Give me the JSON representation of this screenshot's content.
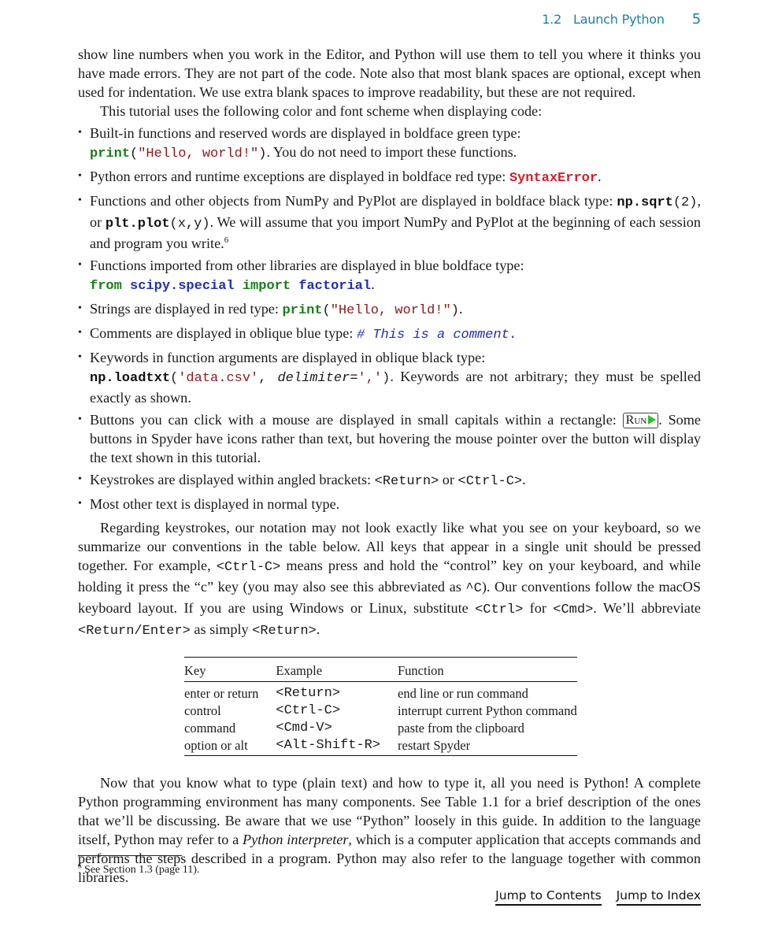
{
  "header": {
    "section_number": "1.2",
    "section_title": "Launch Python",
    "page_number": "5"
  },
  "intro": {
    "para1": "show line numbers when you work in the Editor, and Python will use them to tell you where it thinks you have made errors. They are not part of the code. Note also that most blank spaces are optional, except when used for indentation. We use extra blank spaces to improve readability, but these are not required.",
    "para2": "This tutorial uses the following color and font scheme when displaying code:"
  },
  "bullets": {
    "b1": {
      "text": "Built-in functions and reserved words are displayed in boldface green type:",
      "code_fn": "print",
      "code_open": "(",
      "code_str": "\"Hello, world!\"",
      "code_close": ")",
      "after": ". You do not need to import these functions."
    },
    "b2": {
      "text": "Python errors and runtime exceptions are displayed in boldface red type: ",
      "code": "SyntaxError",
      "after": "."
    },
    "b3": {
      "text": "Functions and other objects from NumPy and PyPlot are displayed in boldface black type: ",
      "code1_fn": "np.sqrt",
      "code1_args": "(2)",
      "mid": ", or ",
      "code2_fn": "plt.plot",
      "code2_args": "(x,y)",
      "after": ". We will assume that you import NumPy and PyPlot at the beginning of each session and program you write.",
      "footnote_ref": "6"
    },
    "b4": {
      "text": "Functions imported from other libraries are displayed in blue boldface type:",
      "kw_from": "from",
      "lib": "scipy.special",
      "kw_import": "import",
      "fn": "factorial",
      "after": "."
    },
    "b5": {
      "text": "Strings are displayed in red type: ",
      "code_fn": "print",
      "code_open": "(",
      "code_str": "\"Hello, world!\"",
      "code_close": ")",
      "after": "."
    },
    "b6": {
      "text": "Comments are displayed in oblique blue type: ",
      "code": "# This is a comment."
    },
    "b7": {
      "text": "Keywords in function arguments are displayed in oblique black type:",
      "code_fn": "np.loadtxt",
      "code_open": "(",
      "code_str1": "'data.csv'",
      "code_sep": ", ",
      "code_kwarg": "delimiter",
      "code_eq": "=",
      "code_str2": "','",
      "code_close": ")",
      "after": ". Keywords are not arbitrary; they must be spelled exactly as shown."
    },
    "b8": {
      "text": "Buttons you can click with a mouse are displayed in small capitals within a rectangle: ",
      "button_label": "Run",
      "button_icon": "play-icon",
      "after": ". Some buttons in Spyder have icons rather than text, but hovering the mouse pointer over the button will display the text shown in this tutorial."
    },
    "b9": {
      "text": "Keystrokes are displayed within angled brackets: ",
      "key1": "<Return>",
      "mid": " or ",
      "key2": "<Ctrl-C>",
      "after": "."
    },
    "b10": {
      "text": "Most other text is displayed in normal type."
    }
  },
  "keystrokes_para": {
    "t1": "Regarding keystrokes, our notation may not look exactly like what you see on your keyboard, so we summarize our conventions in the table below. All keys that appear in a single unit should be pressed together. For example, ",
    "k1": "<Ctrl-C>",
    "t2": " means press and hold the “control” key on your keyboard, and while holding it press the “c” key (you may also see this abbreviated as ",
    "k2": "^C",
    "t3": "). Our conventions follow the macOS keyboard layout. If you are using Windows or Linux, substitute ",
    "k3": "<Ctrl>",
    "t4": " for ",
    "k4": "<Cmd>",
    "t5": ". We’ll abbreviate ",
    "k5": "<Return/Enter>",
    "t6": " as simply ",
    "k6": "<Return>",
    "t7": "."
  },
  "key_table": {
    "headers": [
      "Key",
      "Example",
      "Function"
    ],
    "rows": [
      [
        "enter or return",
        "<Return>",
        "end line or run command"
      ],
      [
        "control",
        "<Ctrl-C>",
        "interrupt current Python command"
      ],
      [
        "command",
        "<Cmd-V>",
        "paste from the clipboard"
      ],
      [
        "option or alt",
        "<Alt-Shift-R>",
        "restart Spyder"
      ]
    ]
  },
  "closing_para": {
    "t1": "Now that you know what to type (plain text) and how to type it, all you need is Python! A complete Python programming environment has many components. See Table 1.1 for a brief description of the ones that we’ll be discussing. Be aware that we use “Python” loosely in this guide. In addition to the language itself, Python may refer to a ",
    "em": "Python interpreter",
    "t2": ", which is a computer application that accepts commands and performs the steps described in a program. Python may also refer to the language together with common libraries."
  },
  "footnote": {
    "number": "6",
    "text": " See Section 1.3 (page 11)."
  },
  "nav": {
    "contents": "Jump to Contents",
    "index": "Jump to Index"
  }
}
